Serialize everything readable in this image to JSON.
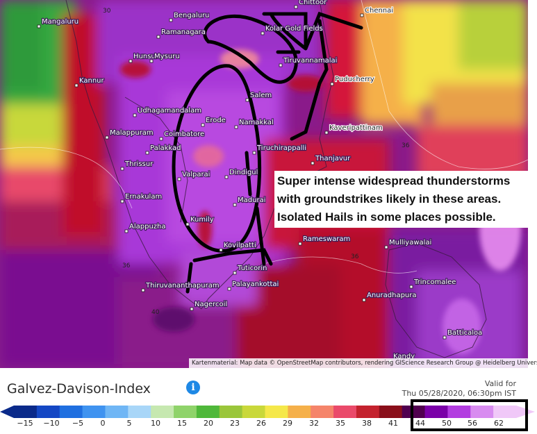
{
  "map": {
    "cities": [
      {
        "name": "Mangaluru"
      },
      {
        "name": "Bengaluru"
      },
      {
        "name": "Chittoor"
      },
      {
        "name": "Chennai"
      },
      {
        "name": "Ramanagara"
      },
      {
        "name": "Kolar Gold Fields"
      },
      {
        "name": "Hunsur"
      },
      {
        "name": "Mysuru"
      },
      {
        "name": "Tiruvannamalai"
      },
      {
        "name": "Kannur"
      },
      {
        "name": "Puducherry"
      },
      {
        "name": "Salem"
      },
      {
        "name": "Udhagamandalam"
      },
      {
        "name": "Erode"
      },
      {
        "name": "Namakkal"
      },
      {
        "name": "Kaveripattinam"
      },
      {
        "name": "Malappuram"
      },
      {
        "name": "Coimbatore"
      },
      {
        "name": "Palakkad"
      },
      {
        "name": "Tiruchirappalli"
      },
      {
        "name": "Thanjavur"
      },
      {
        "name": "Thrissur"
      },
      {
        "name": "Valparai"
      },
      {
        "name": "Dindigul"
      },
      {
        "name": "Ernakulam"
      },
      {
        "name": "Madurai"
      },
      {
        "name": "Alappuzha"
      },
      {
        "name": "Kumily"
      },
      {
        "name": "Rameswaram"
      },
      {
        "name": "Mulliyawalai"
      },
      {
        "name": "Kovilpatti"
      },
      {
        "name": "Tuticorin"
      },
      {
        "name": "Palayankottai"
      },
      {
        "name": "Thiruvananthapuram"
      },
      {
        "name": "Trincomalee"
      },
      {
        "name": "Nagercoil"
      },
      {
        "name": "Anuradhapura"
      },
      {
        "name": "Batticaloa"
      },
      {
        "name": "Kandy"
      }
    ],
    "contour_labels": [
      "30",
      "36",
      "36",
      "36",
      "40"
    ],
    "attribution": "Kartenmaterial: Map data © OpenStreetMap contributors, rendering GIScience Research Group @ Heidelberg University"
  },
  "annotation": {
    "lines": [
      "Super intense widespread thunderstorms",
      "with groundstrikes likely in these areas.",
      "Isolated Hails in some places possible."
    ]
  },
  "legend": {
    "title": "Galvez-Davison-Index",
    "info_icon": "info-icon",
    "valid_for_label": "Valid for",
    "valid_for_time": "Thu 05/28/2020, 06:30pm IST",
    "ticks": [
      "−15",
      "−10",
      "−5",
      "0",
      "5",
      "10",
      "15",
      "20",
      "23",
      "26",
      "29",
      "32",
      "35",
      "38",
      "41",
      "44",
      "50",
      "56",
      "62"
    ],
    "colors": [
      "#0a2a8a",
      "#1447c4",
      "#1f6fe0",
      "#3f93f0",
      "#6fb6f5",
      "#a8d6f8",
      "#c6e8b0",
      "#8fd36a",
      "#4fb83a",
      "#9ac63a",
      "#c9d83a",
      "#f5e84a",
      "#f5b04a",
      "#f5846a",
      "#ea4a6a",
      "#c4222e",
      "#8a0f1a",
      "#50004f",
      "#7a00a8",
      "#b23de0",
      "#d88cf0",
      "#f0c8f8"
    ]
  }
}
